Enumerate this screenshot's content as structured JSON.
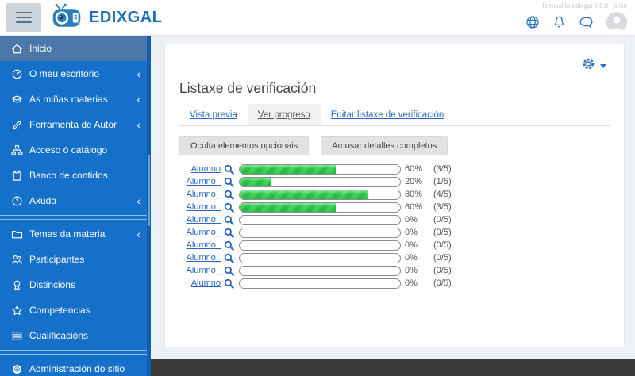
{
  "topbar": {
    "brand": "EDIXGAL",
    "version_text": "formación edixgal 3.6.0 - el/se",
    "icons": [
      "hamburger-icon",
      "globe-icon",
      "bell-icon",
      "chat-icon",
      "avatar"
    ]
  },
  "sidebar": {
    "items": [
      {
        "label": "Inicio",
        "icon": "home-icon",
        "active": true,
        "chevron": false,
        "divider_after": false
      },
      {
        "label": "O meu escritorio",
        "icon": "dashboard-icon",
        "active": false,
        "chevron": true,
        "divider_after": false
      },
      {
        "label": "As miñas materias",
        "icon": "graduation-cap-icon",
        "active": false,
        "chevron": true,
        "divider_after": false
      },
      {
        "label": "Ferramenta de Autor",
        "icon": "pencil-icon",
        "active": false,
        "chevron": true,
        "divider_after": false
      },
      {
        "label": "Acceso ó catálogo",
        "icon": "sitemap-icon",
        "active": false,
        "chevron": false,
        "divider_after": false
      },
      {
        "label": "Banco de contidos",
        "icon": "clipboard-icon",
        "active": false,
        "chevron": false,
        "divider_after": false
      },
      {
        "label": "Axuda",
        "icon": "help-icon",
        "active": false,
        "chevron": true,
        "divider_after": true
      },
      {
        "label": "Temas da materia",
        "icon": "folder-icon",
        "active": false,
        "chevron": true,
        "divider_after": false
      },
      {
        "label": "Participantes",
        "icon": "users-icon",
        "active": false,
        "chevron": false,
        "divider_after": false
      },
      {
        "label": "Distincións",
        "icon": "medal-icon",
        "active": false,
        "chevron": false,
        "divider_after": false
      },
      {
        "label": "Competencias",
        "icon": "star-icon",
        "active": false,
        "chevron": false,
        "divider_after": false
      },
      {
        "label": "Cualificacións",
        "icon": "grades-icon",
        "active": false,
        "chevron": false,
        "divider_after": true
      },
      {
        "label": "Administración do sitio",
        "icon": "gear-icon",
        "active": false,
        "chevron": false,
        "divider_after": false
      }
    ]
  },
  "main": {
    "title": "Listaxe de verificación",
    "settings_icon": "gear-icon",
    "tabs": [
      {
        "label": "Vista previa",
        "active": false
      },
      {
        "label": "Ver progreso",
        "active": true
      },
      {
        "label": "Editar listaxe de verificación",
        "active": false
      }
    ],
    "buttons": {
      "hide_optional": "Oculta elementos opcionais",
      "show_full": "Amosar detalles completos"
    },
    "progress_rows": [
      {
        "name": "Alumno",
        "percent": 60,
        "percent_label": "60%",
        "fraction": "(3/5)"
      },
      {
        "name": "Alumno_",
        "percent": 20,
        "percent_label": "20%",
        "fraction": "(1/5)"
      },
      {
        "name": "Alumno_",
        "percent": 80,
        "percent_label": "80%",
        "fraction": "(4/5)"
      },
      {
        "name": "Alumno_",
        "percent": 60,
        "percent_label": "60%",
        "fraction": "(3/5)"
      },
      {
        "name": "Alumno_",
        "percent": 0,
        "percent_label": "0%",
        "fraction": "(0/5)"
      },
      {
        "name": "Alumno_",
        "percent": 0,
        "percent_label": "0%",
        "fraction": "(0/5)"
      },
      {
        "name": "Alumno_",
        "percent": 0,
        "percent_label": "0%",
        "fraction": "(0/5)"
      },
      {
        "name": "Alumno_",
        "percent": 0,
        "percent_label": "0%",
        "fraction": "(0/5)"
      },
      {
        "name": "Alumno_",
        "percent": 0,
        "percent_label": "0%",
        "fraction": "(0/5)"
      },
      {
        "name": "Alumno",
        "percent": 0,
        "percent_label": "0%",
        "fraction": "(0/5)"
      }
    ]
  },
  "colors": {
    "sidebar_blue": "#1470c8",
    "sidebar_active": "#4d77a8",
    "brand_blue": "#1e6fb5",
    "link_blue": "#2a68bd",
    "icon_blue": "#2b70bd",
    "progress_green": "#3fd35a",
    "progress_green_dark": "#2cc247",
    "footer_dark": "#3a3a3a",
    "content_bg": "#edf1f6"
  }
}
